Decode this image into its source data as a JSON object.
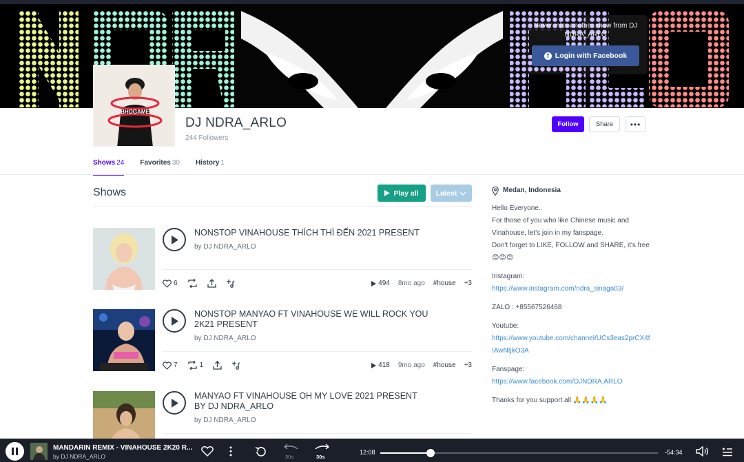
{
  "banner": {
    "login_note": "Never miss another show from DJ NDRA_ARLO",
    "login_button": "Login with Facebook"
  },
  "profile": {
    "name": "DJ NDRA_ARLO",
    "followers": "244 Followers",
    "follow_label": "Follow",
    "share_label": "Share",
    "more_label": "•••",
    "avatar_shirt_text": "BHOGAME"
  },
  "tabs": [
    {
      "label": "Shows",
      "count": "24"
    },
    {
      "label": "Favorites",
      "count": "30"
    },
    {
      "label": "History",
      "count": "1"
    }
  ],
  "shows_section": {
    "title": "Shows",
    "play_all": "Play all",
    "sort": "Latest"
  },
  "shows": [
    {
      "title": "NONSTOP VINAHOUSE THÍCH THÌ ĐẾN 2021 PRESENT",
      "by": "by DJ NDRA_ARLO",
      "likes": "6",
      "reposts": "",
      "plays": "494",
      "age": "8mo ago",
      "tag": "#house",
      "more_tags": "+3"
    },
    {
      "title": "NONSTOP MANYAO FT VINAHOUSE WE WILL ROCK YOU 2K21 PRESENT",
      "by": "by DJ NDRA_ARLO",
      "likes": "7",
      "reposts": "1",
      "plays": "418",
      "age": "9mo ago",
      "tag": "#house",
      "more_tags": "+3"
    },
    {
      "title": "MANYAO FT VINAHOUSE OH MY LOVE 2021 PRESENT BY DJ NDRA_ARLO",
      "by": "by DJ NDRA_ARLO"
    }
  ],
  "sidebar": {
    "location": "Medan, Indonesia",
    "bio_lines": [
      "Hello Everyone..",
      "For those of you who like Chinese music and Vinahouse, let's join in my fanspage.",
      "Don't forget to LIKE, FOLLOW and SHARE, it's free 😊😊😊"
    ],
    "instagram_label": "Instagram:",
    "instagram_url": "https://www.instagram.com/ndra_sinaga03/",
    "zalo": "ZALO : +85567526468",
    "youtube_label": "Youtube:",
    "youtube_url": "https://www.youtube.com/channel/UCs3eas2prCX4fIAwNtjkO3A",
    "fanspage_label": "Fanspage:",
    "fanspage_url": "https://www.facebook.com/DJNDRA.ARLO",
    "thanks": "Thanks for you support all 🙏🙏🙏🙏"
  },
  "player": {
    "title": "MANDARIN REMIX - VINAHOUSE 2K20 R...",
    "by": "by DJ NDRA_ARLO",
    "back_label": "30s",
    "forward_label": "30s",
    "elapsed": "12:08",
    "remaining": "-54:34",
    "progress": 0.18
  },
  "colors": {
    "accent": "#5000ff",
    "play_all": "#16a085",
    "facebook": "#3b5998",
    "link": "#3b8ed9",
    "player_bg": "#1b1f2a"
  }
}
